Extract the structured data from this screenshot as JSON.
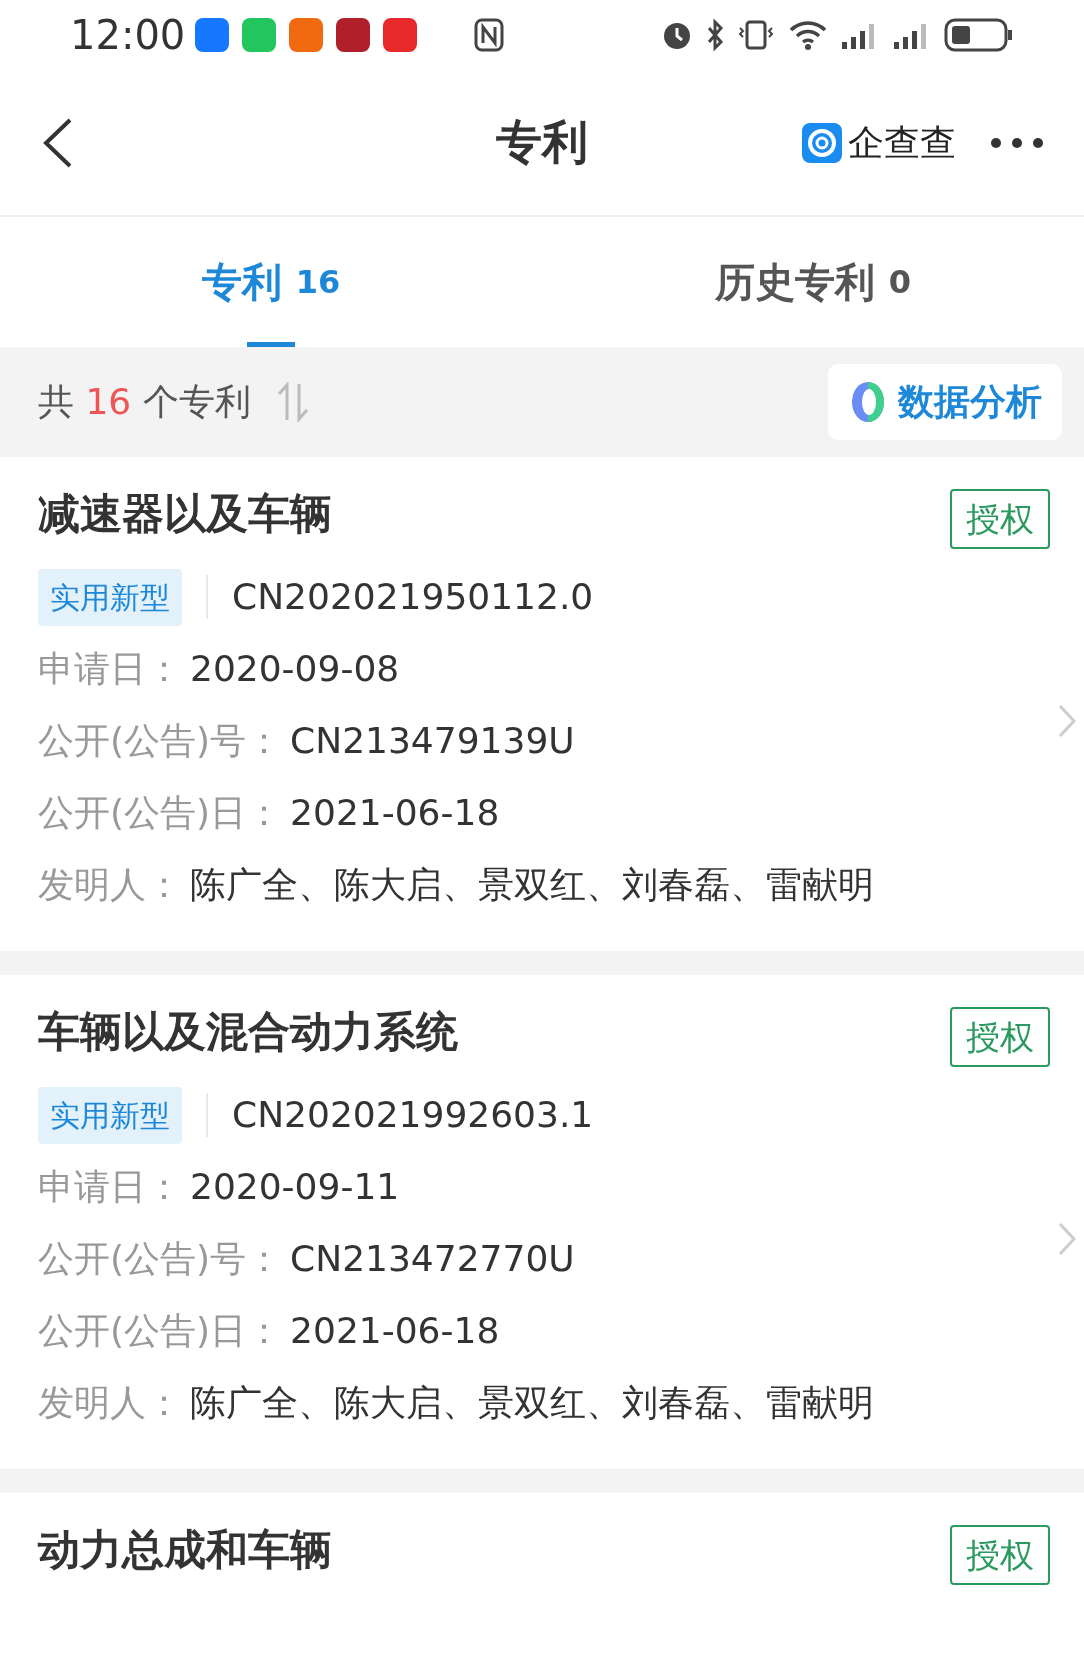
{
  "status_bar": {
    "time": "12:00"
  },
  "header": {
    "title": "专利",
    "brand": "企查查"
  },
  "tabs": [
    {
      "label": "专利",
      "count": "16",
      "selected": true
    },
    {
      "label": "历史专利",
      "count": "0",
      "selected": false
    }
  ],
  "summary": {
    "prefix": "共",
    "count": "16",
    "suffix": "个专利",
    "action": "数据分析"
  },
  "patents": [
    {
      "title": "减速器以及车辆",
      "status": "授权",
      "type": "实用新型",
      "number": "CN202021950112.0",
      "fields": [
        {
          "label": "申请日：",
          "value": "2020-09-08"
        },
        {
          "label": "公开(公告)号：",
          "value": "CN213479139U"
        },
        {
          "label": "公开(公告)日：",
          "value": "2021-06-18"
        },
        {
          "label": "发明人：",
          "value": "陈广全、陈大启、景双红、刘春磊、雷献明"
        }
      ]
    },
    {
      "title": "车辆以及混合动力系统",
      "status": "授权",
      "type": "实用新型",
      "number": "CN202021992603.1",
      "fields": [
        {
          "label": "申请日：",
          "value": "2020-09-11"
        },
        {
          "label": "公开(公告)号：",
          "value": "CN213472770U"
        },
        {
          "label": "公开(公告)日：",
          "value": "2021-06-18"
        },
        {
          "label": "发明人：",
          "value": "陈广全、陈大启、景双红、刘春磊、雷献明"
        }
      ]
    },
    {
      "title": "动力总成和车辆",
      "status": "授权"
    }
  ]
}
